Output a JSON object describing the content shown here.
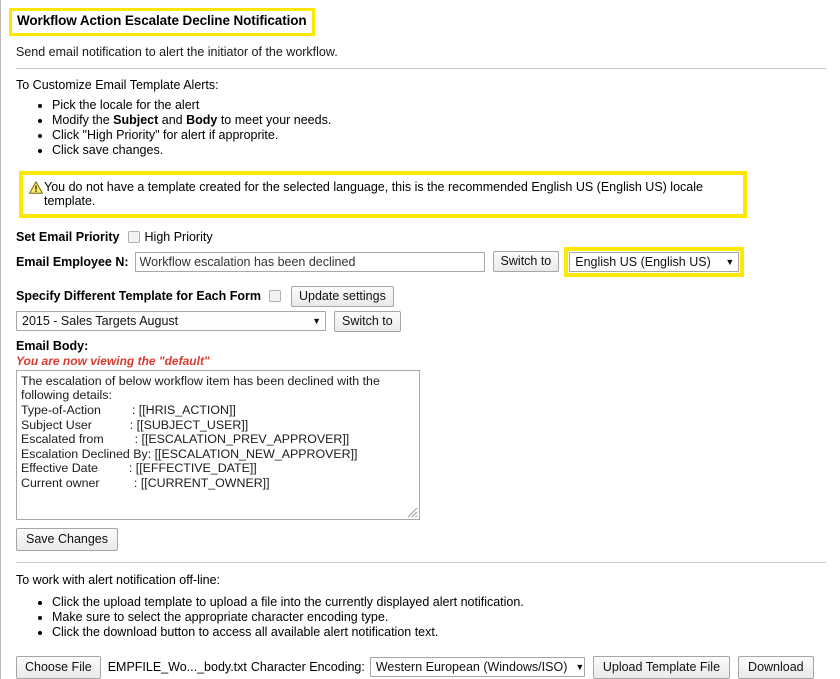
{
  "header": {
    "title": "Workflow Action Escalate Decline Notification",
    "subtitle": "Send email notification to alert the initiator of the workflow."
  },
  "instructions": {
    "lead": "To Customize Email Template Alerts:",
    "bullets": [
      {
        "pre": "Pick the locale for the alert",
        "bold1": "",
        "mid": "",
        "bold2": "",
        "post": ""
      },
      {
        "pre": "Modify the ",
        "bold1": "Subject",
        "mid": " and ",
        "bold2": "Body",
        "post": " to meet your needs."
      },
      {
        "pre": "Click \"High Priority\" for alert if approprite.",
        "bold1": "",
        "mid": "",
        "bold2": "",
        "post": ""
      },
      {
        "pre": "Click save changes.",
        "bold1": "",
        "mid": "",
        "bold2": "",
        "post": ""
      }
    ]
  },
  "warning": {
    "icon": "warning-triangle-icon",
    "text": "You do not have a template created for the selected language, this is the recommended English US (English US) locale template.",
    "highlight_color": "#ffe800"
  },
  "priority_row": {
    "label": "Set Email Priority",
    "checkbox_label": "High Priority",
    "checked": false
  },
  "subject_row": {
    "label": "Email Employee N:",
    "value": "Workflow escalation has been declined",
    "placeholder": "",
    "switch_button": "Switch to",
    "locale_select": "English US (English US)",
    "caret": "▼"
  },
  "template_row": {
    "label": "Specify Different Template for Each Form",
    "checked": false,
    "update_button": "Update settings",
    "form_select": "2015 - Sales Targets August",
    "switch_button": "Switch to",
    "caret": "▼"
  },
  "email_body": {
    "label": "Email Body:",
    "viewing_note": "You are now viewing the \"default\"",
    "content": "The escalation of below workflow item has been declined with the\nfollowing details:\nType-of-Action         : [[HRIS_ACTION]]\nSubject User           : [[SUBJECT_USER]]\nEscalated from         : [[ESCALATION_PREV_APPROVER]]\nEscalation Declined By: [[ESCALATION_NEW_APPROVER]]\nEffective Date         : [[EFFECTIVE_DATE]]\nCurrent owner          : [[CURRENT_OWNER]]",
    "save_button": "Save Changes"
  },
  "offline": {
    "lead": "To work with alert notification off-line:",
    "bullets": [
      "Click the upload template to upload a file into the currently displayed alert notification.",
      "Make sure to select the appropriate character encoding type.",
      "Click the download button to access all available alert notification text."
    ]
  },
  "filebar": {
    "choose_file_button": "Choose File",
    "file_name": "EMPFILE_Wo..._body.txt",
    "encoding_label": "Character Encoding:",
    "encoding_value": "Western European (Windows/ISO)",
    "caret": "▼",
    "upload_button": "Upload Template File",
    "download_button": "Download"
  }
}
